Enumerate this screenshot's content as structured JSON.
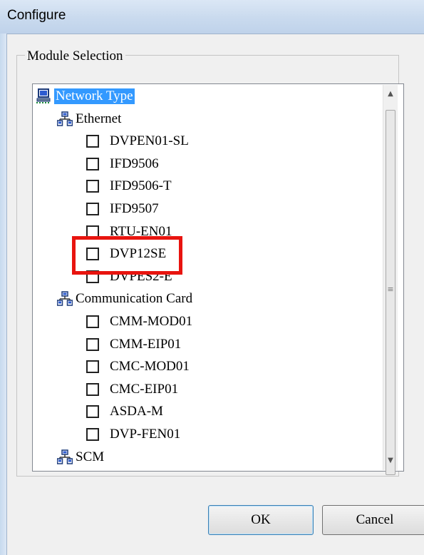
{
  "window": {
    "title": "Configure"
  },
  "group": {
    "legend": "Module Selection"
  },
  "tree": {
    "root": {
      "label": "Network Type",
      "icon": "network-computer-icon",
      "selected": true
    },
    "categories": [
      {
        "label": "Ethernet",
        "icon": "network-node-icon",
        "items": [
          "DVPEN01-SL",
          "IFD9506",
          "IFD9506-T",
          "IFD9507",
          "RTU-EN01",
          "DVP12SE",
          "DVPES2-E"
        ]
      },
      {
        "label": "Communication Card",
        "icon": "network-node-icon",
        "items": [
          "CMM-MOD01",
          "CMM-EIP01",
          "CMC-MOD01",
          "CMC-EIP01",
          "ASDA-M",
          "DVP-FEN01"
        ]
      },
      {
        "label": "SCM",
        "icon": "network-node-icon",
        "items": []
      }
    ]
  },
  "scrollbar": {
    "up_icon": "scroll-up-arrow-icon",
    "down_icon": "scroll-down-arrow-icon",
    "grip": "≡"
  },
  "highlight": {
    "target": "DVP12SE",
    "color": "#e8140f"
  },
  "buttons": {
    "ok": "OK",
    "cancel": "Cancel"
  }
}
